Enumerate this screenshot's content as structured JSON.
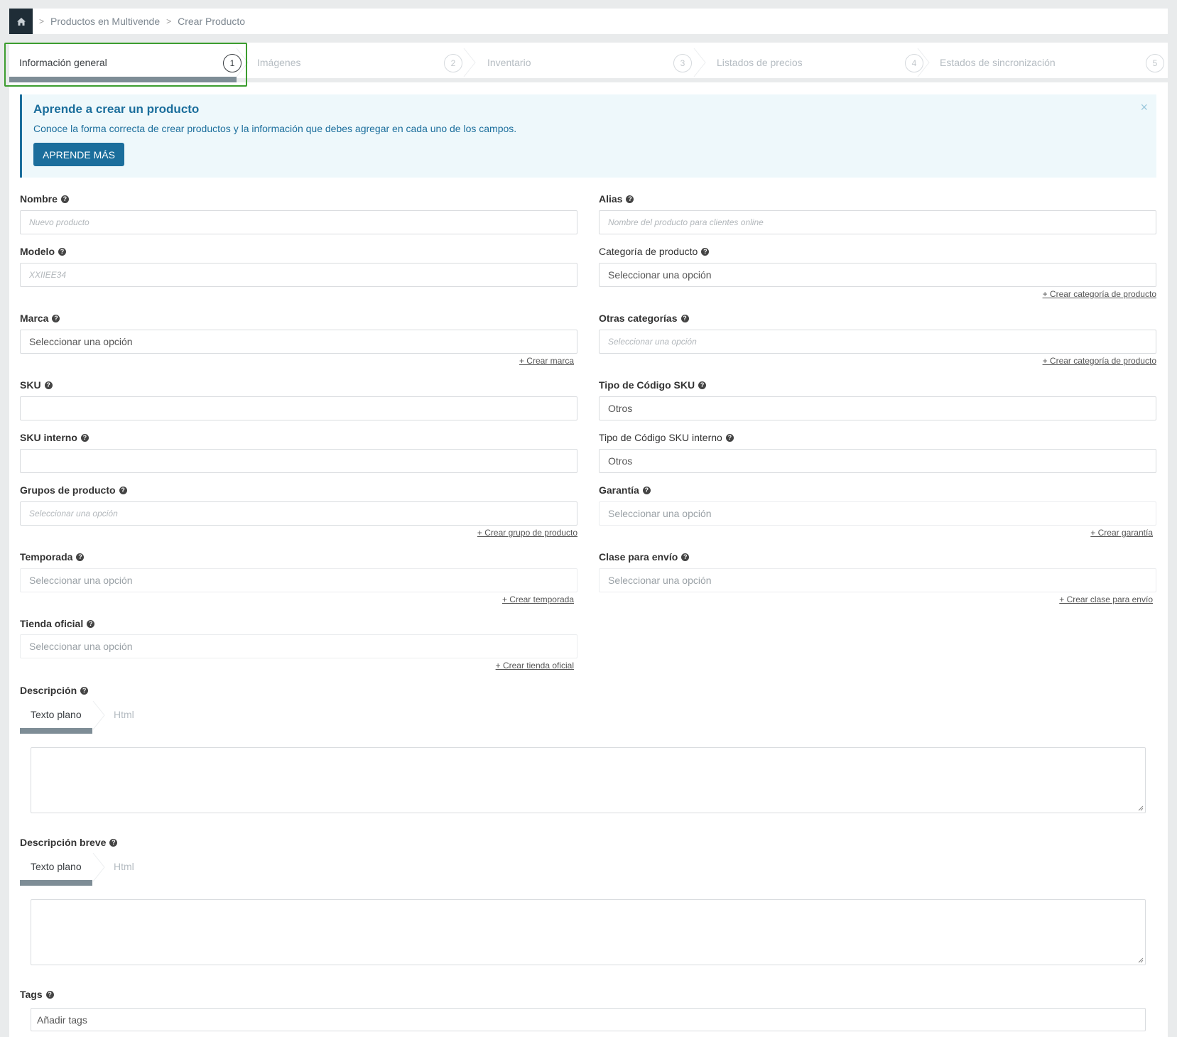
{
  "breadcrumb": {
    "items": [
      "Productos en Multivende",
      "Crear Producto"
    ]
  },
  "steps": [
    {
      "label": "Información general",
      "num": "1"
    },
    {
      "label": "Imágenes",
      "num": "2"
    },
    {
      "label": "Inventario",
      "num": "3"
    },
    {
      "label": "Listados de precios",
      "num": "4"
    },
    {
      "label": "Estados de sincronización",
      "num": "5"
    }
  ],
  "alert": {
    "title": "Aprende a crear un producto",
    "text": "Conoce la forma correcta de crear productos y la información que debes agregar en cada uno de los campos.",
    "button": "APRENDE MÁS",
    "close": "×"
  },
  "fields": {
    "nombre": {
      "label": "Nombre",
      "placeholder": "Nuevo producto"
    },
    "alias": {
      "label": "Alias",
      "placeholder": "Nombre del producto para clientes online"
    },
    "modelo": {
      "label": "Modelo",
      "placeholder": "XXIIEE34"
    },
    "categoria": {
      "label": "Categoría de producto",
      "value": "Seleccionar una opción",
      "link": "+ Crear categoría de producto"
    },
    "marca": {
      "label": "Marca",
      "value": "Seleccionar una opción",
      "link": "+ Crear marca"
    },
    "otras_categorias": {
      "label": "Otras categorías",
      "placeholder": "Seleccionar una opción",
      "link": "+ Crear categoría de producto"
    },
    "sku": {
      "label": "SKU"
    },
    "tipo_sku": {
      "label": "Tipo de Código SKU",
      "value": "Otros"
    },
    "sku_interno": {
      "label": "SKU interno"
    },
    "tipo_sku_interno": {
      "label": "Tipo de Código SKU interno",
      "value": "Otros"
    },
    "grupos": {
      "label": "Grupos de producto",
      "placeholder": "Seleccionar una opción",
      "link": "+ Crear grupo de producto"
    },
    "garantia": {
      "label": "Garantía",
      "placeholder": "Seleccionar una opción",
      "link": "+ Crear garantía"
    },
    "temporada": {
      "label": "Temporada",
      "placeholder": "Seleccionar una opción",
      "link": "+ Crear temporada"
    },
    "clase_envio": {
      "label": "Clase para envío",
      "placeholder": "Seleccionar una opción",
      "link": "+ Crear clase para envío"
    },
    "tienda": {
      "label": "Tienda oficial",
      "placeholder": "Seleccionar una opción",
      "link": "+ Crear tienda oficial"
    },
    "descripcion": {
      "label": "Descripción",
      "tab_plain": "Texto plano",
      "tab_html": "Html"
    },
    "descripcion_breve": {
      "label": "Descripción breve",
      "tab_plain": "Texto plano",
      "tab_html": "Html"
    },
    "tags": {
      "label": "Tags",
      "placeholder": "Añadir tags"
    }
  },
  "help_glyph": "?"
}
